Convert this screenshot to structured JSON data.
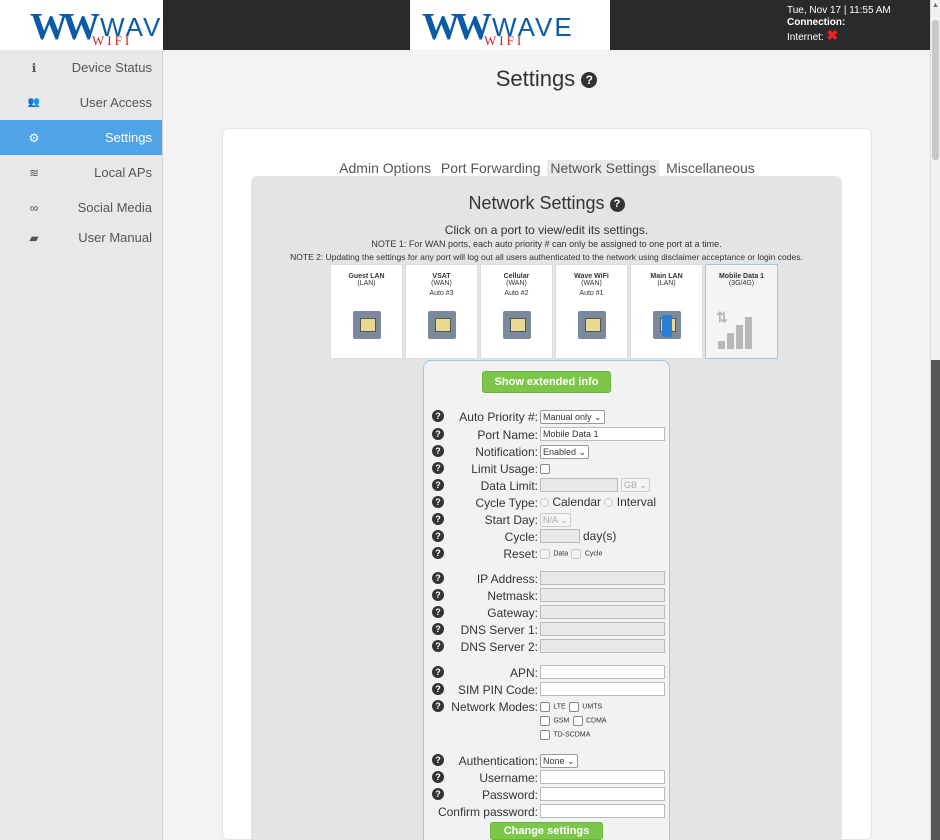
{
  "header": {
    "logo_mark": "W",
    "logo_text": "WAVE",
    "logo_sub": "WIFI",
    "datetime": "Tue, Nov 17 | 11:55 AM",
    "connection_label": "Connection:",
    "internet_label": "Internet:",
    "internet_status_icon": "x"
  },
  "sidebar": {
    "items": [
      {
        "icon": "info-icon",
        "glyph": "ℹ",
        "label": "Device Status"
      },
      {
        "icon": "users-icon",
        "glyph": "👥",
        "label": "User Access"
      },
      {
        "icon": "gears-icon",
        "glyph": "⚙",
        "label": "Settings"
      },
      {
        "icon": "wifi-icon",
        "glyph": "≋",
        "label": "Local APs"
      },
      {
        "icon": "link-icon",
        "glyph": "∞",
        "label": "Social Media"
      },
      {
        "icon": "book-icon",
        "glyph": "▰",
        "label": "User Manual"
      }
    ],
    "active_index": 2,
    "active_color": "#4ea4e6"
  },
  "page": {
    "title": "Settings",
    "tabs": [
      "Admin Options",
      "Port Forwarding",
      "Network Settings",
      "Miscellaneous"
    ],
    "active_tab": 2
  },
  "network": {
    "title": "Network Settings",
    "instruction": "Click on a port to view/edit its settings.",
    "note1": "NOTE 1: For WAN ports, each auto priority # can only be assigned to one port at a time.",
    "note2": "NOTE 2: Updating the settings for any port will log out all users authenticated to the network using disclaimer acceptance or login codes."
  },
  "ports": [
    {
      "name": "Guest LAN",
      "type": "(LAN)",
      "auto": ""
    },
    {
      "name": "VSAT",
      "type": "(WAN)",
      "auto": "Auto #3"
    },
    {
      "name": "Cellular",
      "type": "(WAN)",
      "auto": "Auto #2"
    },
    {
      "name": "Wave WiFi",
      "type": "(WAN)",
      "auto": "Auto #1"
    },
    {
      "name": "Main LAN",
      "type": "(LAN)",
      "auto": ""
    },
    {
      "name": "Mobile Data 1",
      "type": "(3G/4G)",
      "auto": ""
    }
  ],
  "form": {
    "extended_button": "Show extended info",
    "auto_priority_label": "Auto Priority #:",
    "auto_priority_value": "Manual only",
    "port_name_label": "Port Name:",
    "port_name_value": "Mobile Data 1",
    "notification_label": "Notification:",
    "notification_value": "Enabled",
    "limit_usage_label": "Limit Usage:",
    "data_limit_label": "Data Limit:",
    "data_limit_unit": "GB",
    "cycle_type_label": "Cycle Type:",
    "cycle_calendar": "Calendar",
    "cycle_interval": "Interval",
    "start_day_label": "Start Day:",
    "start_day_value": "N/A",
    "cycle_label": "Cycle:",
    "cycle_unit": "day(s)",
    "reset_label": "Reset:",
    "reset_data": "Data",
    "reset_cycle": "Cycle",
    "ip_label": "IP Address:",
    "netmask_label": "Netmask:",
    "gateway_label": "Gateway:",
    "dns1_label": "DNS Server 1:",
    "dns2_label": "DNS Server 2:",
    "apn_label": "APN:",
    "sim_pin_label": "SIM PIN Code:",
    "network_modes_label": "Network Modes:",
    "modes": [
      "LTE",
      "UMTS",
      "GSM",
      "CDMA",
      "TD-SCDMA"
    ],
    "auth_label": "Authentication:",
    "auth_value": "None",
    "username_label": "Username:",
    "password_label": "Password:",
    "confirm_password_label": "Confirm password:",
    "change_button": "Change settings"
  }
}
